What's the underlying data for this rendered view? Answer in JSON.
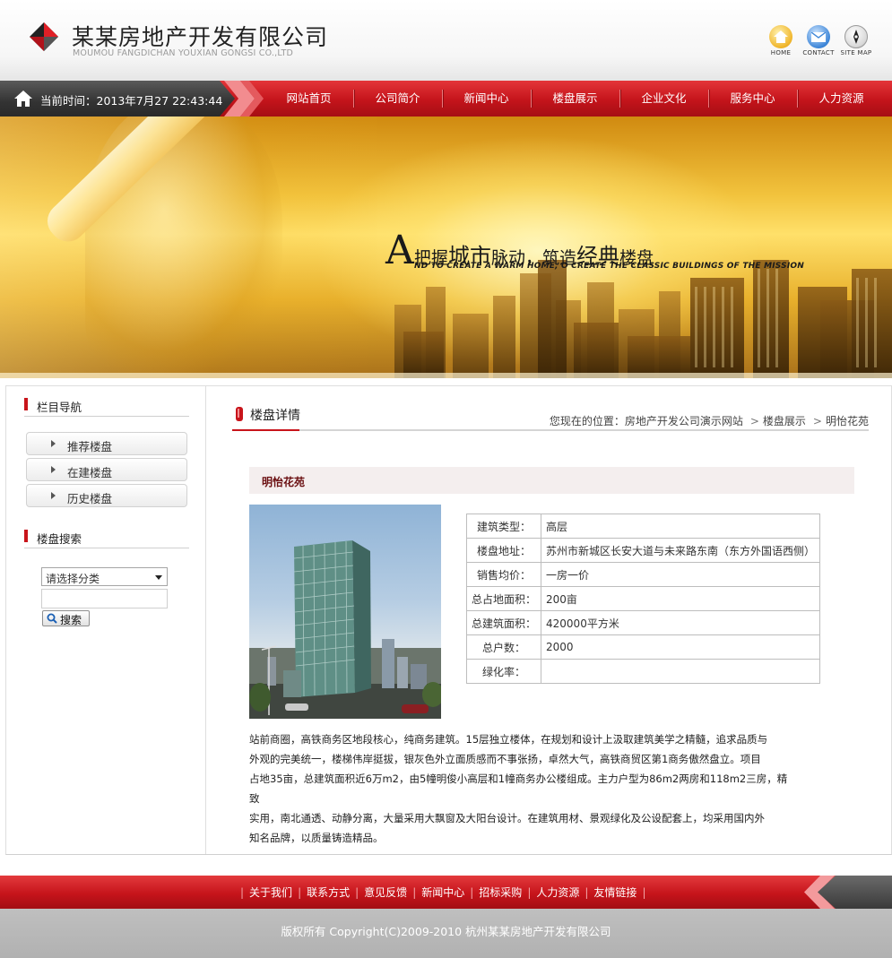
{
  "header": {
    "company_name": "某某房地产开发有限公司",
    "company_pinyin": "MOUMOU FANGDICHAN YOUXIAN GONGSI CO.,LTD",
    "quick_links": [
      {
        "label": "HOME",
        "icon": "home-icon"
      },
      {
        "label": "CONTACT",
        "icon": "envelope-icon"
      },
      {
        "label": "SITE MAP",
        "icon": "sitemap-icon"
      }
    ]
  },
  "nav": {
    "time_label": "当前时间：2013年7月27 22:43:44",
    "items": [
      "网站首页",
      "公司简介",
      "新闻中心",
      "楼盘展示",
      "企业文化",
      "服务中心",
      "人力资源"
    ]
  },
  "banner": {
    "big_letter": "A",
    "slogan_parts": [
      "把握",
      "城市",
      "脉动，筑造",
      "经典",
      "楼盘"
    ],
    "slogan_en": "ND TO CREATE A WARM HOME,    O CREATE THE CLASSIC BUILDINGS OF THE MISSION"
  },
  "sidebar": {
    "nav_title": "栏目导航",
    "nav_items": [
      "推荐楼盘",
      "在建楼盘",
      "历史楼盘"
    ],
    "search_title": "楼盘搜索",
    "select_value": "请选择分类",
    "search_button": "搜索"
  },
  "main": {
    "section_title": "楼盘详情",
    "breadcrumb": {
      "prefix": "您现在的位置：",
      "items": [
        "房地产开发公司演示网站",
        "楼盘展示",
        "明怡花苑"
      ]
    },
    "property_name": "明怡花苑",
    "details": [
      {
        "key": "建筑类型：",
        "value": "高层"
      },
      {
        "key": "楼盘地址：",
        "value": "苏州市新城区长安大道与未来路东南（东方外国语西侧）"
      },
      {
        "key": "销售均价：",
        "value": "一房一价"
      },
      {
        "key": "总占地面积：",
        "value": "200亩"
      },
      {
        "key": "总建筑面积：",
        "value": "420000平方米"
      },
      {
        "key": "总户数：",
        "value": "2000"
      },
      {
        "key": "绿化率：",
        "value": ""
      }
    ],
    "description_lines": [
      "站前商圈，高铁商务区地段核心，纯商务建筑。15层独立楼体，在规划和设计上汲取建筑美学之精髓，追求品质与",
      "外观的完美统一，楼梯伟岸挺拔，银灰色外立面质感而不事张扬，卓然大气，高铁商贸区第1商务傲然盘立。项目",
      "占地35亩，总建筑面积近6万m2，由5幢明俊小高层和1幢商务办公楼组成。主力户型为86m2两房和118m2三房，精致",
      "实用，南北通透、动静分离，大量采用大飘窗及大阳台设计。在建筑用材、景观绿化及公设配套上，均采用国内外",
      "知名品牌，以质量铸造精品。"
    ]
  },
  "footer": {
    "links": [
      "关于我们",
      "联系方式",
      "意见反馈",
      "新闻中心",
      "招标采购",
      "人力资源",
      "友情链接"
    ],
    "copyright": "版权所有  Copyright(C)2009-2010 杭州某某房地产开发有限公司"
  },
  "colors": {
    "brand_red": "#c8141b",
    "dark_gray": "#333333",
    "footer_gray": "#b8b8b8"
  }
}
